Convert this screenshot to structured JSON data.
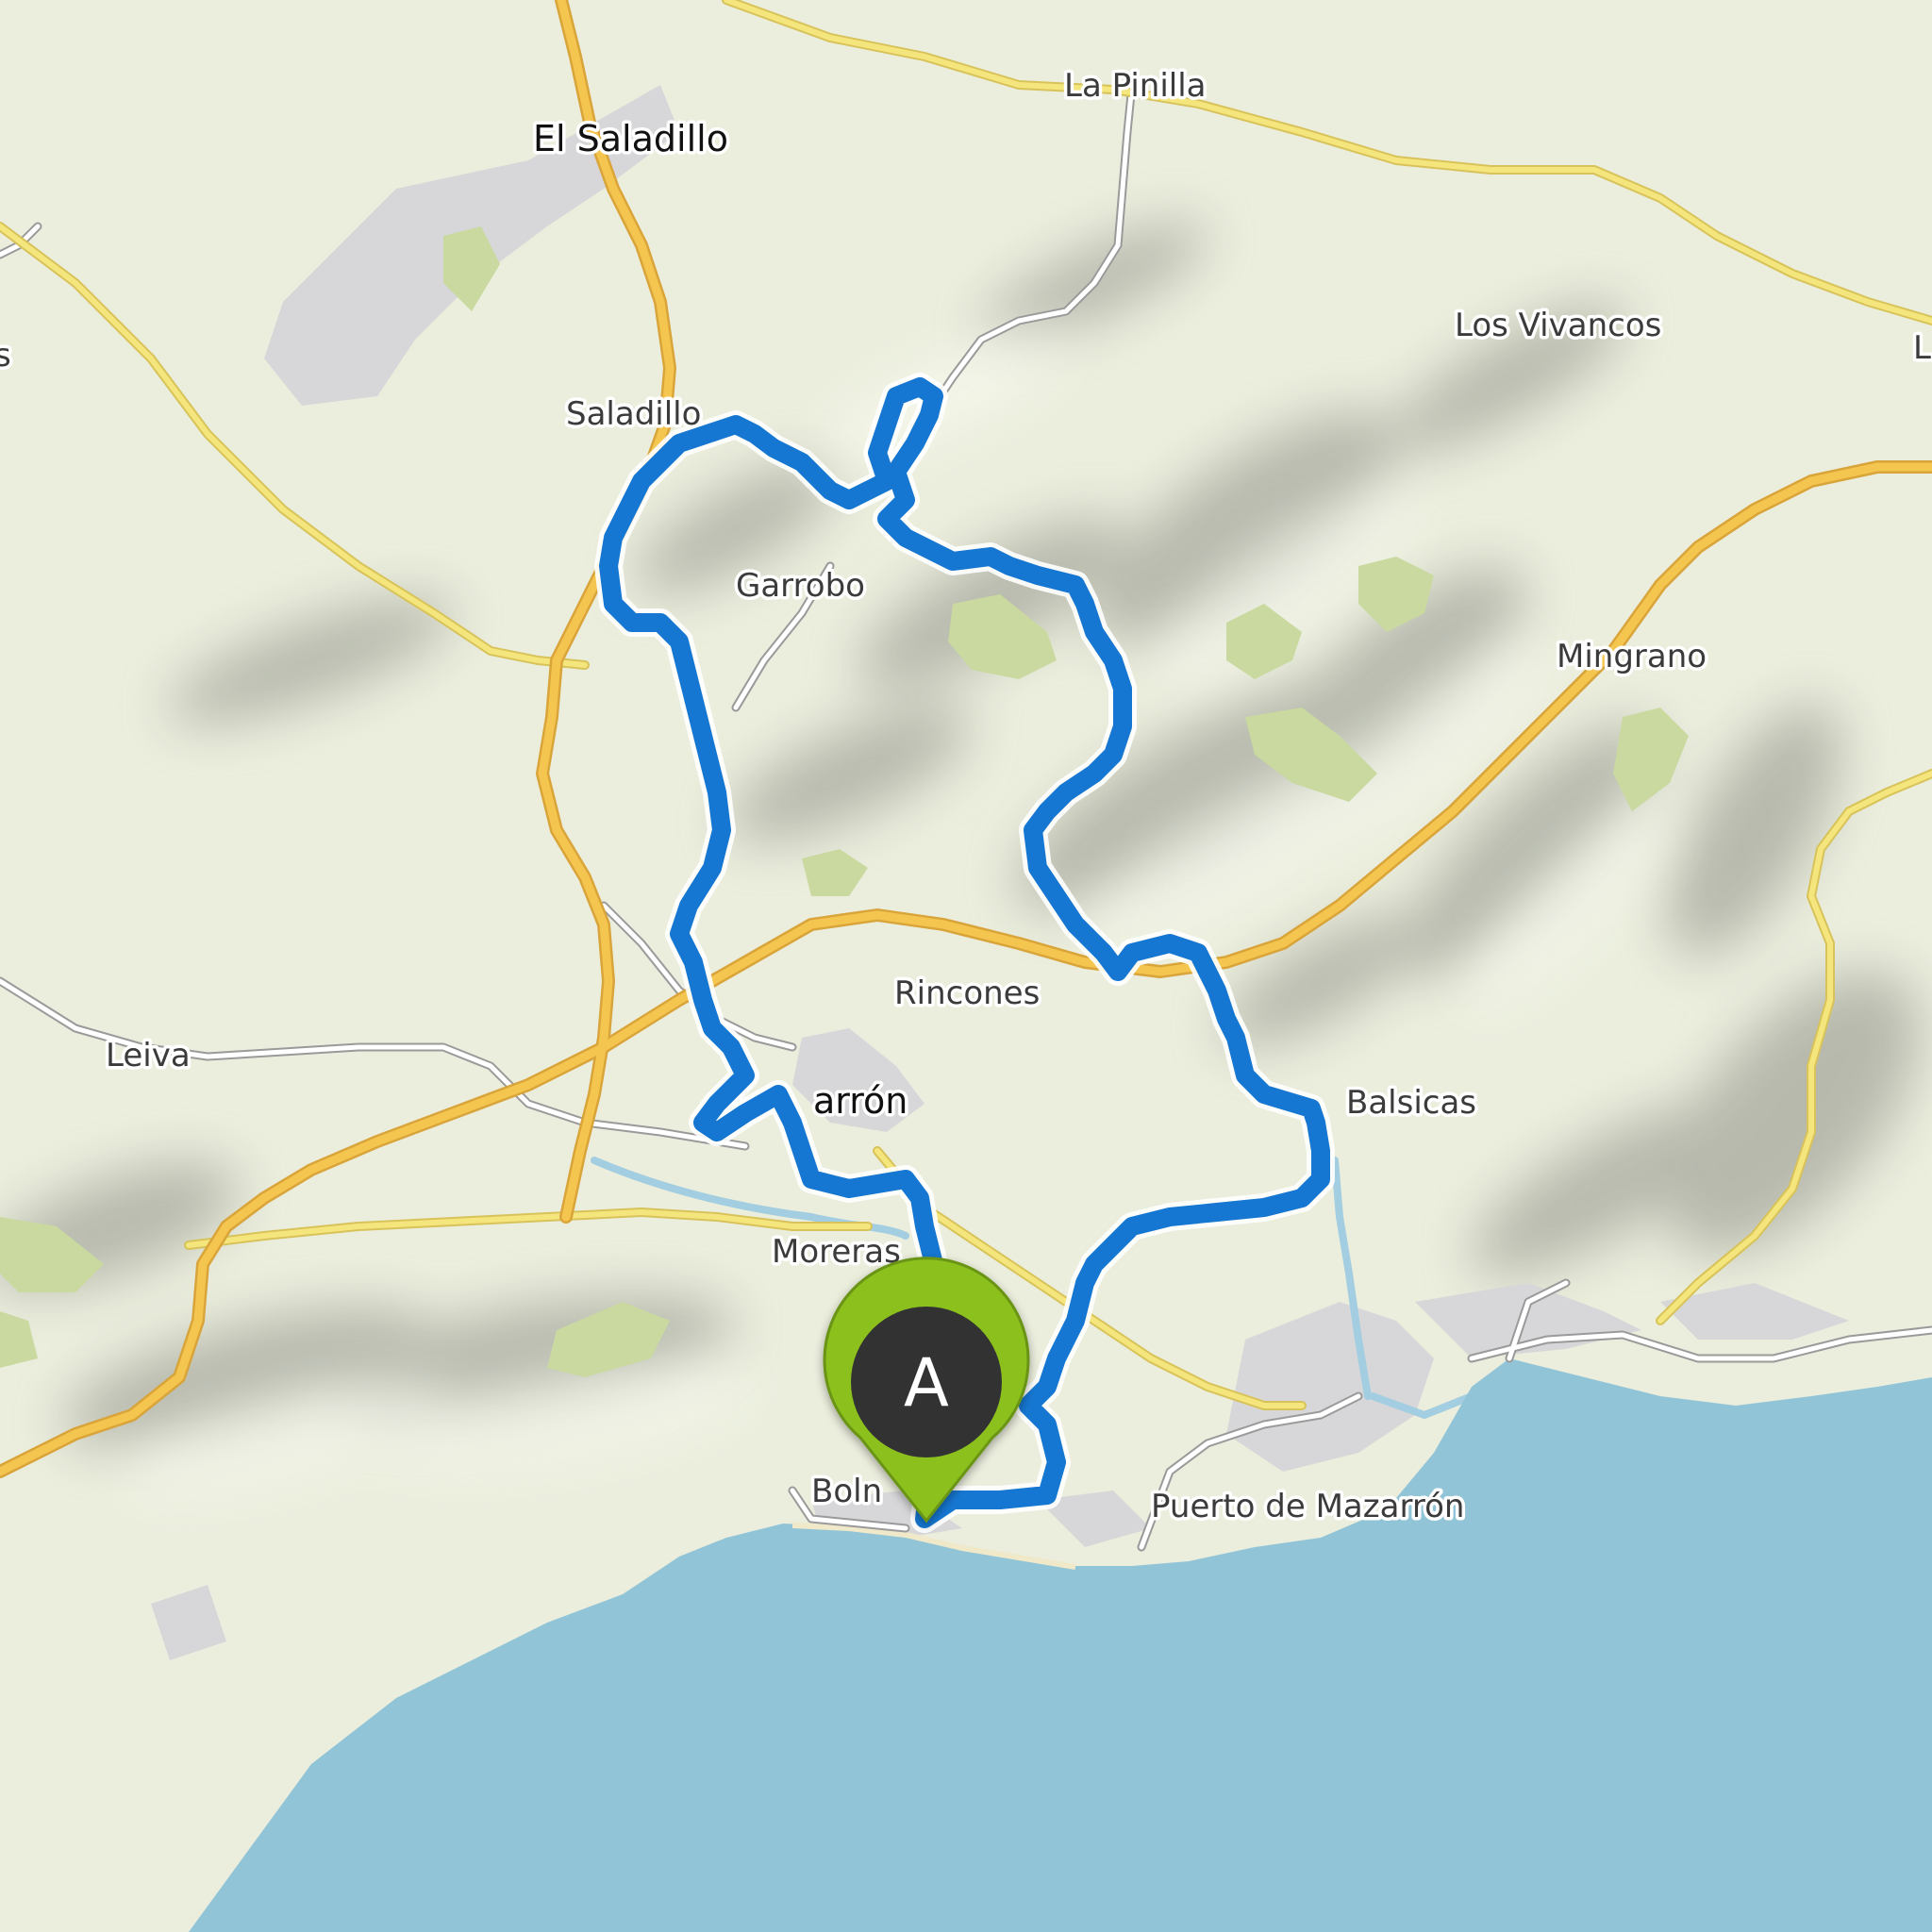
{
  "map": {
    "colors": {
      "land": "#ebeedd",
      "sea": "#92c4d8",
      "route": "#1677d2",
      "primary_road": "#f5c64f",
      "secondary_road": "#f3e27a",
      "minor_road": "#ffffff",
      "park": "#c9d9a0",
      "urban": "#d7d7d9",
      "river": "#a3cde0"
    },
    "labels": {
      "el_saladillo": "El Saladillo",
      "la_pinilla": "La Pinilla",
      "los_vivancos": "Los Vivancos",
      "saladillo": "Saladillo",
      "garrobo": "Garrobo",
      "mingrano": "Mingrano",
      "rincones": "Rincones",
      "leiva": "Leiva",
      "mazarron": "arrón",
      "balsicas": "Balsicas",
      "moreras": "Moreras",
      "bolnuevo": "Boln",
      "puerto": "Puerto de Mazarrón",
      "edge_left": "s",
      "edge_right": "L"
    },
    "marker": {
      "letter": "A",
      "icon": "map-pin-icon",
      "color": "#8cc01e",
      "inner_color": "#333333"
    }
  }
}
